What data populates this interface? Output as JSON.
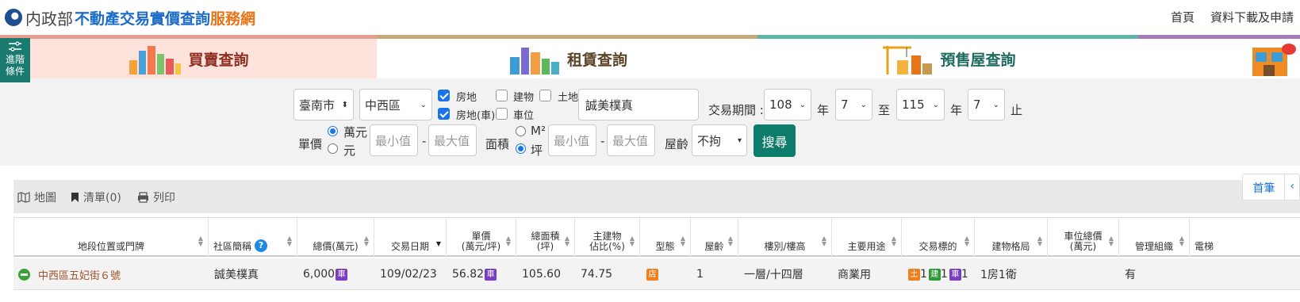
{
  "header": {
    "ministry": "内政部",
    "site_main": "不動產交易實價查詢",
    "site_sub": "服務網",
    "nav": [
      "首頁",
      "資料下載及申請"
    ]
  },
  "tabs": [
    {
      "label": "買賣查詢"
    },
    {
      "label": "租賃查詢"
    },
    {
      "label": "預售屋查詢"
    }
  ],
  "advanced_button": {
    "line1": "進階",
    "line2": "條件"
  },
  "filters": {
    "city": "臺南市",
    "district": "中西區",
    "type_options": [
      {
        "label": "房地",
        "checked": true
      },
      {
        "label": "建物",
        "checked": false
      },
      {
        "label": "土地",
        "checked": false
      },
      {
        "label": "房地(車)",
        "checked": true
      },
      {
        "label": "車位",
        "checked": false
      }
    ],
    "keyword": "誠美樸真",
    "period_label": "交易期間 :",
    "start_year": "108",
    "start_month": "7",
    "end_year": "115",
    "end_month": "7",
    "year_unit": "年",
    "to_label": "至",
    "until_label": "止",
    "unit_price_label": "單價",
    "unit_options": [
      {
        "label": "萬元",
        "selected": true
      },
      {
        "label": "元",
        "selected": false
      }
    ],
    "min_placeholder": "最小值",
    "max_placeholder": "最大值",
    "dash": "-",
    "area_label": "面積",
    "area_options": [
      {
        "label": "M²",
        "selected": false
      },
      {
        "label": "坪",
        "selected": true
      }
    ],
    "age_label": "屋齡",
    "age_value": "不拘",
    "search_label": "搜尋"
  },
  "toolbar": {
    "map_label": "地圖",
    "list_label": "清單(0)",
    "print_label": "列印",
    "pager_first": "首筆",
    "pager_prev": "‹"
  },
  "table": {
    "headers": [
      "地段位置或門牌",
      "社區簡稱",
      "總價(萬元)",
      "交易日期",
      "單價\n(萬元/坪)",
      "總面積\n(坪)",
      "主建物\n佔比(%)",
      "型態",
      "屋齡",
      "樓別/樓高",
      "主要用途",
      "交易標的",
      "建物格局",
      "車位總價\n(萬元)",
      "管理組織",
      "電梯"
    ],
    "row": {
      "address": "中西區五妃街６號",
      "community": "誠美樸真",
      "total_price": "6,000",
      "date": "109/02/23",
      "unit_price": "56.82",
      "area": "105.60",
      "main_ratio": "74.75",
      "type_badge": "店",
      "age": "1",
      "floor": "一層/十四層",
      "usage": "商業用",
      "target_land": "土",
      "target_land_n": "1",
      "target_build": "建",
      "target_build_n": "1",
      "target_car": "車",
      "target_car_n": "1",
      "layout": "1房1衛",
      "parking_price": "",
      "management": "有",
      "elevator": ""
    },
    "badge_car": "車"
  },
  "colors": {
    "brand_blue": "#1b6cc6",
    "brand_orange": "#e8741a",
    "teal": "#0e7c6b",
    "purple_badge": "#7a3fc0",
    "orange_badge": "#f0801e",
    "green_badge": "#2e9a3a"
  }
}
